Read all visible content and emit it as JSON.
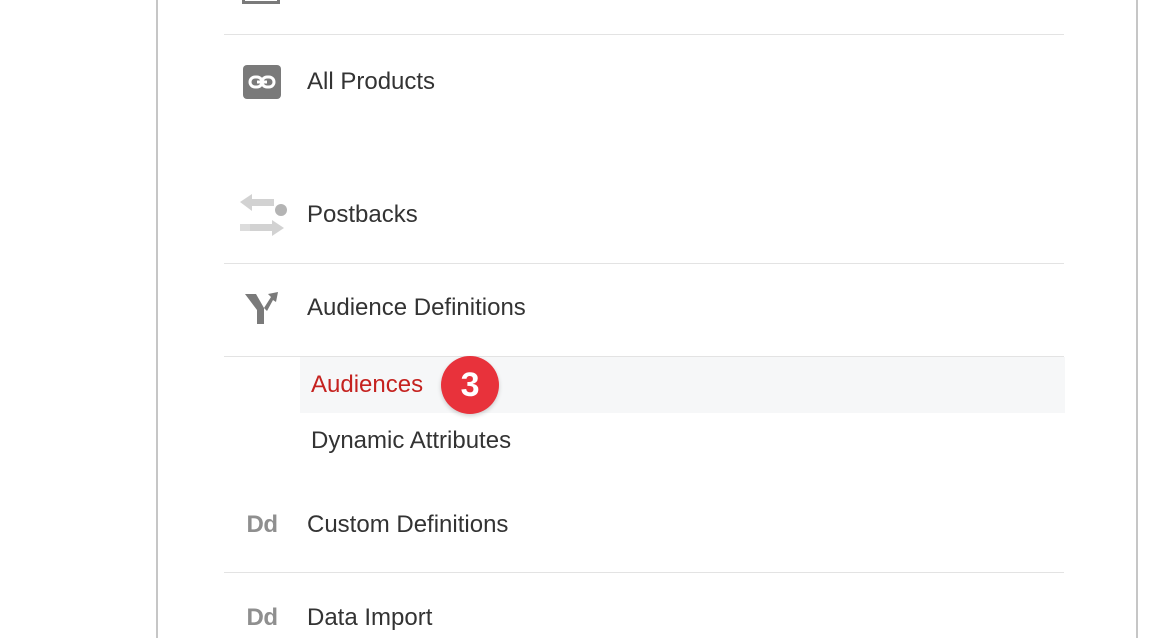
{
  "nav": {
    "items": [
      {
        "label": "All Products",
        "icon": "link-icon"
      },
      {
        "label": "Postbacks",
        "icon": "postback-arrows-icon"
      },
      {
        "label": "Audience Definitions",
        "icon": "fork-icon"
      },
      {
        "label": "Custom Definitions",
        "icon": "dd-icon",
        "icon_text": "Dd"
      },
      {
        "label": "Data Import",
        "icon": "dd-icon",
        "icon_text": "Dd"
      }
    ],
    "subitems": [
      {
        "label": "Audiences",
        "active": true,
        "badge": "3"
      },
      {
        "label": "Dynamic Attributes",
        "active": false
      }
    ]
  },
  "colors": {
    "active_text": "#c5221f",
    "active_bg": "#f6f7f8",
    "badge_bg": "#e8323b",
    "icon_gray": "#7a7a7a"
  }
}
